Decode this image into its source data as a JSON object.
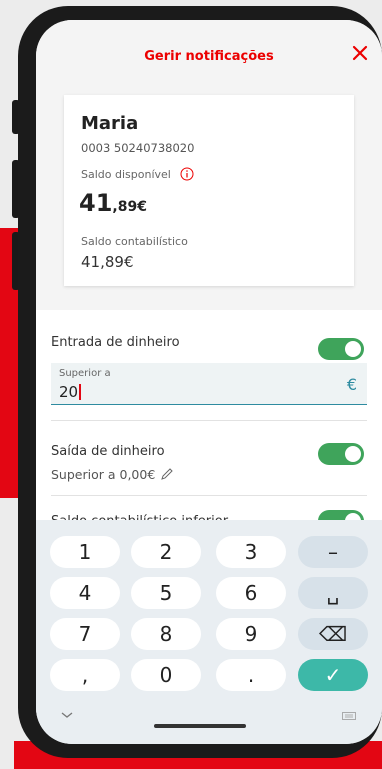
{
  "header": {
    "title": "Gerir notificações"
  },
  "card": {
    "name": "Maria",
    "account_number": "0003 50240738020",
    "available_label": "Saldo disponível",
    "balance_int": "41",
    "balance_dec": ",89€",
    "accounting_label": "Saldo contabilístico",
    "accounting_value": "41,89€"
  },
  "settings": {
    "income": {
      "label": "Entrada de dinheiro",
      "toggle_on": true
    },
    "income_input": {
      "label": "Superior a",
      "value": "20",
      "currency": "€"
    },
    "outgoing": {
      "label": "Saída de dinheiro",
      "toggle_on": true,
      "threshold": "Superior a 0,00€"
    },
    "low_balance": {
      "label": "Saldo contabilístico inferior",
      "toggle_on": true
    }
  },
  "keyboard": {
    "keys": [
      "1",
      "2",
      "3",
      "–",
      "4",
      "5",
      "6",
      "␣",
      "7",
      "8",
      "9",
      "⌫",
      ",",
      "0",
      ".",
      "✓"
    ]
  },
  "colors": {
    "brand_red": "#ec0000",
    "toggle_green": "#3fa45b",
    "confirm_teal": "#3db8a8",
    "input_accent": "#2e8ba0"
  }
}
